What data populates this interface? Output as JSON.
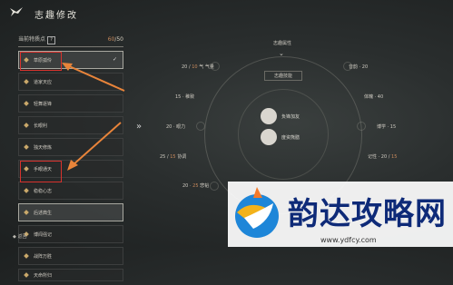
{
  "header": {
    "title": "志趣修改"
  },
  "panel": {
    "heading": "当前特质点",
    "help": "?",
    "count_used": "60",
    "count_total": "/50"
  },
  "traits": [
    {
      "label": "草原孤伶",
      "selected": true
    },
    {
      "label": "道家天应",
      "selected": false
    },
    {
      "label": "轻舞逐锋",
      "selected": false
    },
    {
      "label": "长眼利",
      "selected": false
    },
    {
      "label": "独天修炼",
      "selected": false
    },
    {
      "label": "手眼通天",
      "selected": false
    },
    {
      "label": "稳稳心志",
      "selected": false
    },
    {
      "label": "后述典生",
      "selected": false
    },
    {
      "label": "博闻强记",
      "selected": false
    },
    {
      "label": "战阵万胜",
      "selected": false
    },
    {
      "label": "天命所归",
      "selected": false
    }
  ],
  "nav_arrow": "»",
  "center": {
    "attr_title": "志趣属性",
    "skill_title": "志趣技能",
    "skills": [
      {
        "label": "负锋加友"
      },
      {
        "label": "度资熊膳"
      }
    ]
  },
  "stats_left": [
    {
      "value": "20",
      "extra": "10",
      "name": "气量"
    },
    {
      "value": "15",
      "extra": "",
      "name": "稚致"
    },
    {
      "value": "20",
      "extra": "",
      "name": "眼力"
    },
    {
      "value": "25",
      "extra": "15",
      "name": "协调"
    },
    {
      "value": "20",
      "extra": "25",
      "name": "悲韬"
    }
  ],
  "stats_right": [
    {
      "name": "音韵",
      "value": "20"
    },
    {
      "name": "体魄",
      "value": "40"
    },
    {
      "name": "博学",
      "value": "15"
    },
    {
      "name": "记性",
      "value": "20",
      "extra": "15"
    }
  ],
  "footer": {
    "label": "返回"
  },
  "watermark": {
    "text": "韵达攻略网",
    "url": "www.ydfcy.com"
  },
  "colors": {
    "accent": "#c98a5c",
    "annotation_red": "#d8322d",
    "annotation_orange": "#e8843a"
  }
}
